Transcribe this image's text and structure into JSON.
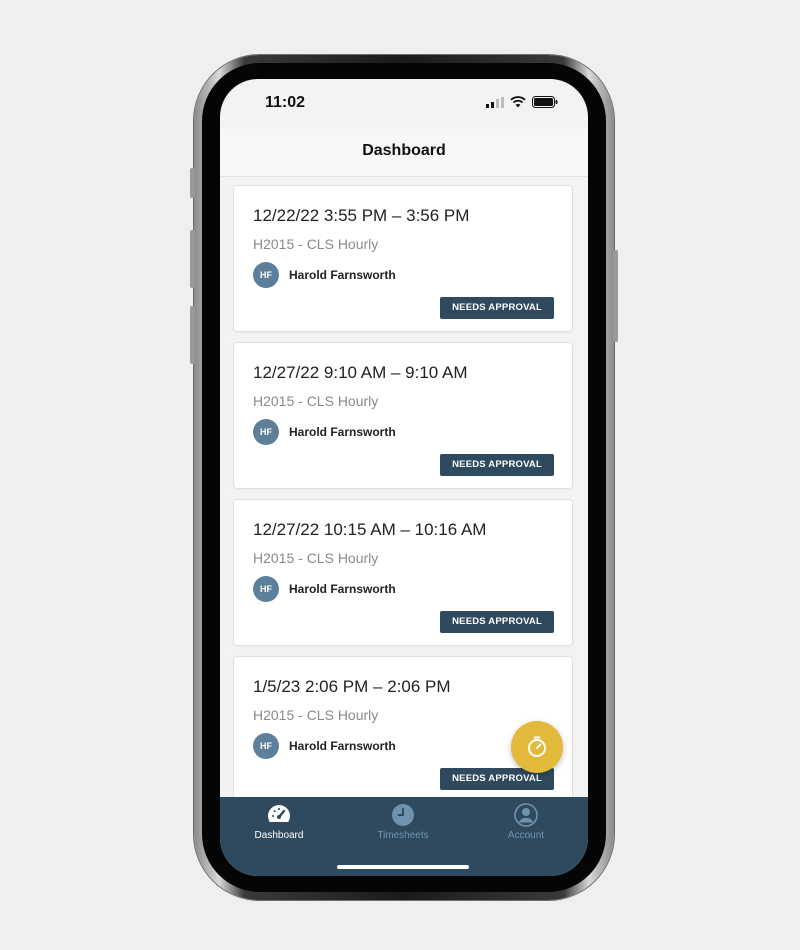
{
  "status_bar": {
    "time": "11:02"
  },
  "header": {
    "title": "Dashboard"
  },
  "entries": [
    {
      "range": "12/22/22 3:55 PM – 3:56 PM",
      "job": "H2015 - CLS Hourly",
      "initials": "HF",
      "user": "Harold Farnsworth",
      "status": "NEEDS APPROVAL"
    },
    {
      "range": "12/27/22 9:10 AM – 9:10 AM",
      "job": "H2015 - CLS Hourly",
      "initials": "HF",
      "user": "Harold Farnsworth",
      "status": "NEEDS APPROVAL"
    },
    {
      "range": "12/27/22 10:15 AM – 10:16 AM",
      "job": "H2015 - CLS Hourly",
      "initials": "HF",
      "user": "Harold Farnsworth",
      "status": "NEEDS APPROVAL"
    },
    {
      "range": "1/5/23 2:06 PM – 2:06 PM",
      "job": "H2015 - CLS Hourly",
      "initials": "HF",
      "user": "Harold Farnsworth",
      "status": "NEEDS APPROVAL"
    }
  ],
  "fab": {
    "icon": "timer-icon"
  },
  "tabbar": {
    "tabs": [
      {
        "label": "Dashboard",
        "icon": "speedometer-icon",
        "active": true
      },
      {
        "label": "Timesheets",
        "icon": "clock-icon",
        "active": false
      },
      {
        "label": "Account",
        "icon": "user-icon",
        "active": false
      }
    ]
  },
  "colors": {
    "primary": "#2f4a5f",
    "avatar": "#5d7f99",
    "accent": "#e2b93b",
    "inactive_tab": "#6f93ad"
  }
}
